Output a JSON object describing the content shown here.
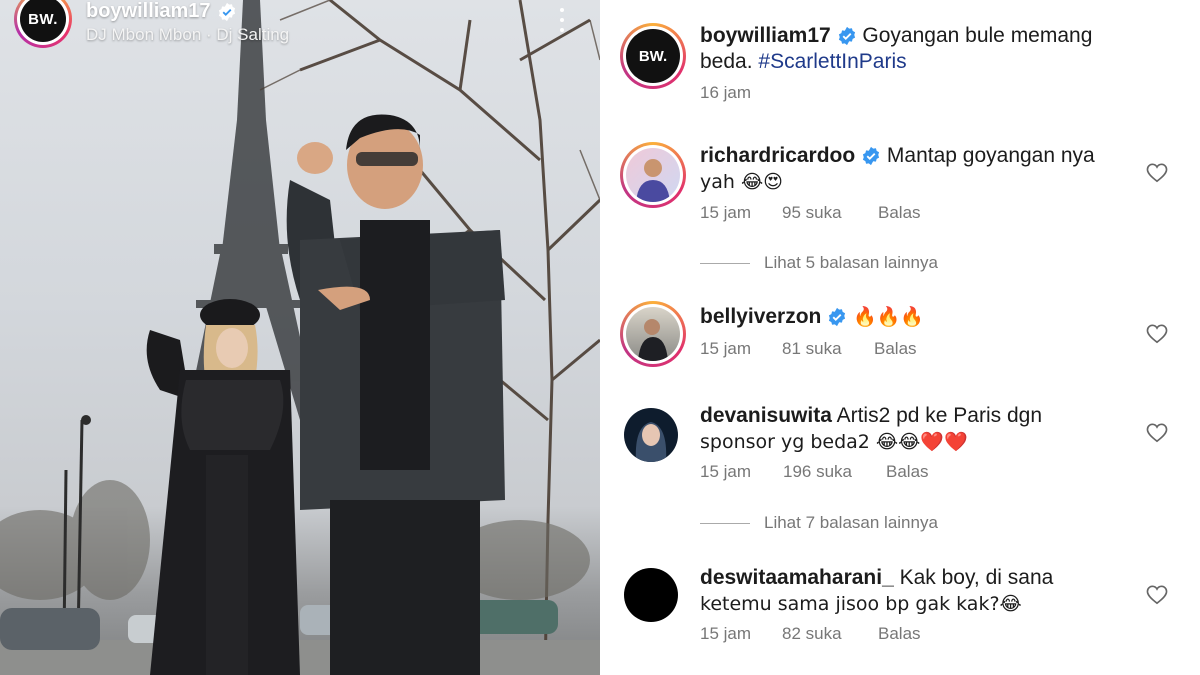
{
  "story": {
    "username": "boywilliam17",
    "music": "DJ Mbon Mbon · Dj Salting",
    "avatar_logo": "BW."
  },
  "post": {
    "username": "boywilliam17",
    "caption": "Goyangan bule memang beda.",
    "hashtag": "#ScarlettInParis",
    "time": "16 jam",
    "avatar_logo": "BW."
  },
  "comments": [
    {
      "username": "richardricardoo",
      "verified": true,
      "text_line1": "Mantap goyangan nya",
      "text_line2": "yah 😂😍",
      "time": "15 jam",
      "likes": "95 suka",
      "reply": "Balas"
    },
    {
      "username": "bellyiverzon",
      "verified": true,
      "text_line1": "🔥🔥🔥",
      "time": "15 jam",
      "likes": "81 suka",
      "reply": "Balas"
    },
    {
      "username": "devanisuwita",
      "verified": false,
      "text_line1": "Artis2 pd ke Paris dgn",
      "text_line2": "sponsor yg beda2 😂😂❤️❤️",
      "time": "15 jam",
      "likes": "196 suka",
      "reply": "Balas"
    },
    {
      "username": "deswitaamaharani_",
      "verified": false,
      "text_line1": "Kak boy, di sana",
      "text_line2": "ketemu sama jisoo bp gak kak?😂",
      "time": "15 jam",
      "likes": "82 suka",
      "reply": "Balas"
    }
  ],
  "view_replies": [
    "Lihat 5 balasan lainnya",
    "Lihat 7 balasan lainnya"
  ],
  "colors": {
    "verified_blue": "#3897f0",
    "muted_text": "#777777",
    "hashtag": "#1f3a8a"
  }
}
